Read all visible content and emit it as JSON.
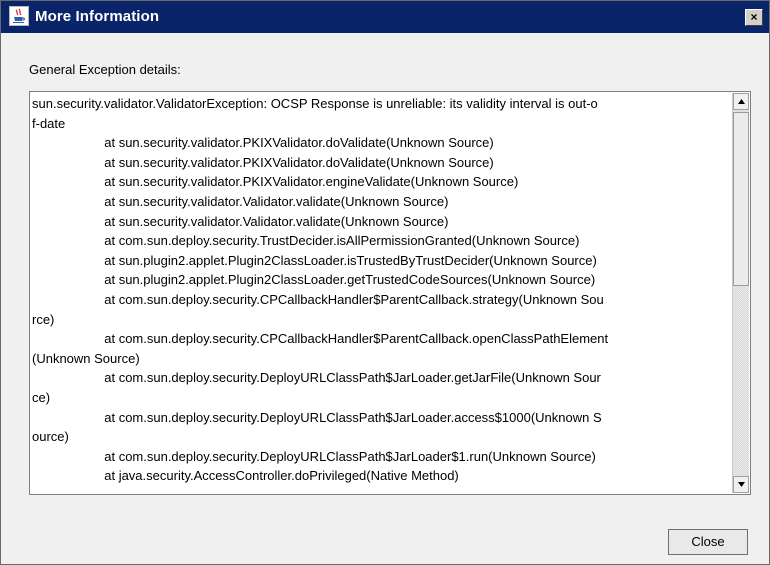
{
  "window": {
    "title": "More Information",
    "close_glyph": "×",
    "title_bar_color": "#0a246a",
    "icon": "java-app-icon"
  },
  "main": {
    "label": "General Exception details:",
    "lines": [
      "sun.security.validator.ValidatorException: OCSP Response is unreliable: its validity interval is out-o",
      "f-date",
      "                    at sun.security.validator.PKIXValidator.doValidate(Unknown Source)",
      "                    at sun.security.validator.PKIXValidator.doValidate(Unknown Source)",
      "                    at sun.security.validator.PKIXValidator.engineValidate(Unknown Source)",
      "                    at sun.security.validator.Validator.validate(Unknown Source)",
      "                    at sun.security.validator.Validator.validate(Unknown Source)",
      "                    at com.sun.deploy.security.TrustDecider.isAllPermissionGranted(Unknown Source)",
      "                    at sun.plugin2.applet.Plugin2ClassLoader.isTrustedByTrustDecider(Unknown Source)",
      "                    at sun.plugin2.applet.Plugin2ClassLoader.getTrustedCodeSources(Unknown Source)",
      "                    at com.sun.deploy.security.CPCallbackHandler$ParentCallback.strategy(Unknown Sou",
      "rce)",
      "                    at com.sun.deploy.security.CPCallbackHandler$ParentCallback.openClassPathElement",
      "(Unknown Source)",
      "                    at com.sun.deploy.security.DeployURLClassPath$JarLoader.getJarFile(Unknown Sour",
      "ce)",
      "                    at com.sun.deploy.security.DeployURLClassPath$JarLoader.access$1000(Unknown S",
      "ource)",
      "                    at com.sun.deploy.security.DeployURLClassPath$JarLoader$1.run(Unknown Source)",
      "                    at java.security.AccessController.doPrivileged(Native Method)"
    ]
  },
  "footer": {
    "close_label": "Close"
  }
}
